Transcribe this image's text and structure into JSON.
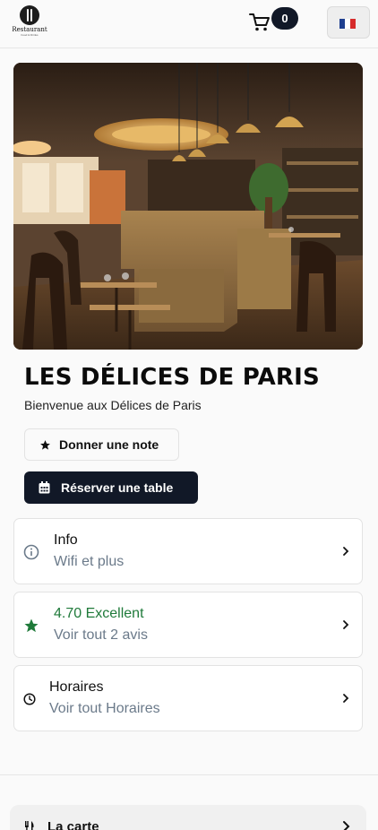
{
  "header": {
    "logo_text": "Restaurant",
    "logo_subtext": "Food & Drinks",
    "cart_count": "0",
    "language_flag": {
      "colors": [
        "#1f3f8f",
        "#ffffff",
        "#d62b2b"
      ]
    }
  },
  "restaurant": {
    "name": "LES DÉLICES DE PARIS",
    "welcome": "Bienvenue aux Délices de Paris"
  },
  "actions": {
    "rate_label": "Donner une note",
    "reserve_label": "Réserver une table"
  },
  "cards": {
    "info": {
      "title": "Info",
      "subtitle": "Wifi et plus",
      "icon": "info-icon"
    },
    "rating": {
      "title": "4.70 Excellent",
      "subtitle": "Voir tout 2 avis",
      "icon": "star-icon",
      "color": "#1f7a3a"
    },
    "hours": {
      "title": "Horaires",
      "subtitle": "Voir tout Horaires",
      "icon": "clock-icon"
    }
  },
  "menu": {
    "label": "La carte",
    "icon": "cutlery-icon"
  },
  "colors": {
    "primary": "#111827",
    "accent_green": "#1f7a3a",
    "muted": "#6b7a8a"
  }
}
